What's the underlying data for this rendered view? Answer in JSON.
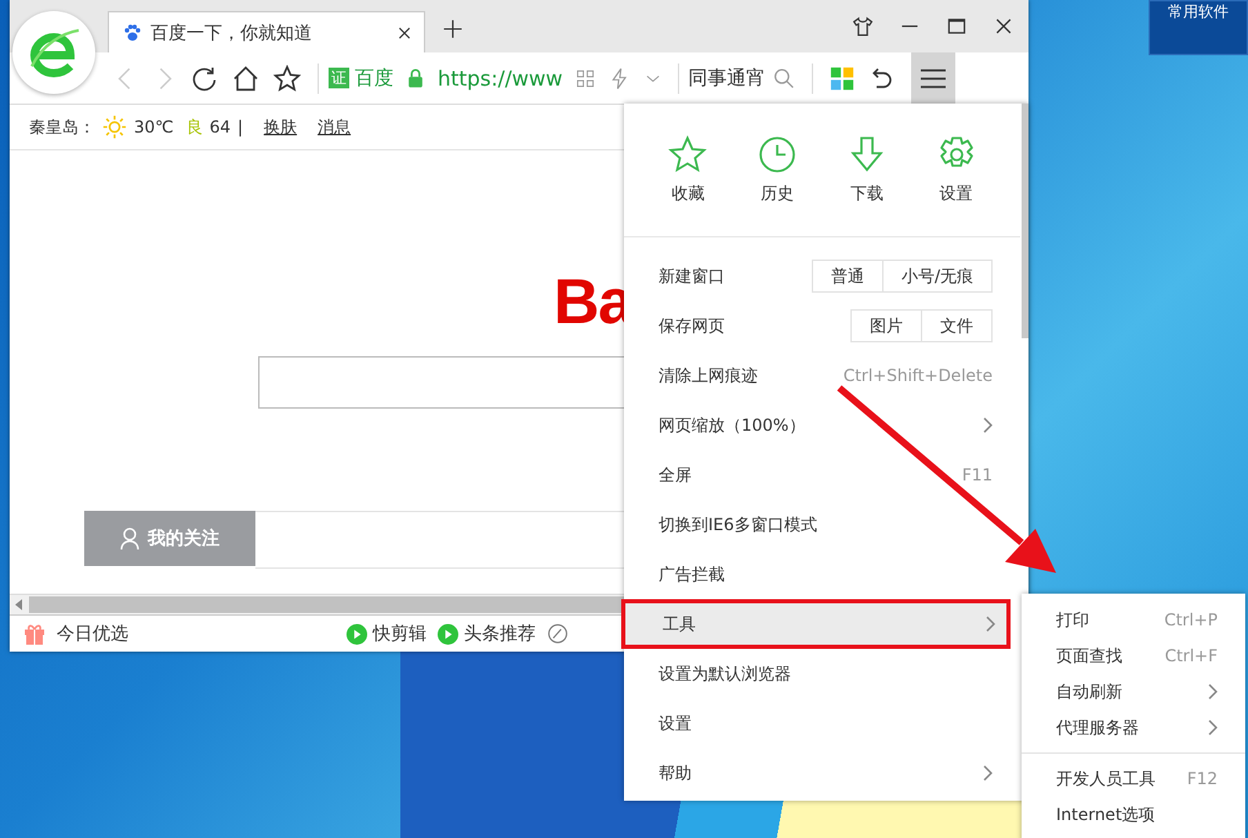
{
  "desktop": {
    "shortcut_label": "常用软件"
  },
  "browser": {
    "tab": {
      "title": "百度一下，你就知道"
    },
    "address": {
      "site_badge": "证",
      "site_name": "百度",
      "url": "https://www"
    },
    "search": {
      "value": "同事通宵"
    },
    "menu_button": {
      "selected": true
    },
    "info_bar": {
      "city": "秦皇岛：",
      "temperature": "30℃",
      "air_quality": "良",
      "aqi": "64",
      "separator": "|",
      "links": [
        "换肤",
        "消息"
      ]
    },
    "page": {
      "logo": "Ba",
      "tab_label": "我的关注"
    },
    "status_bar": {
      "deals": "今日优选",
      "items": [
        "快剪辑",
        "头条推荐"
      ]
    }
  },
  "menu": {
    "top_items": [
      {
        "label": "收藏",
        "kind": "star"
      },
      {
        "label": "历史",
        "kind": "clock"
      },
      {
        "label": "下载",
        "kind": "download"
      },
      {
        "label": "设置",
        "kind": "gear"
      }
    ],
    "items": [
      {
        "label": "新建窗口",
        "kind": "buttons",
        "buttons": [
          "普通",
          "小号/无痕"
        ],
        "selected": false
      },
      {
        "label": "保存网页",
        "kind": "buttons",
        "buttons": [
          "图片",
          "文件"
        ],
        "selected": false
      },
      {
        "label": "清除上网痕迹",
        "kind": "shortcut",
        "shortcut": "Ctrl+Shift+Delete",
        "selected": false
      },
      {
        "label": "网页缩放（100%）",
        "kind": "submenu",
        "selected": false
      },
      {
        "label": "全屏",
        "kind": "shortcut",
        "shortcut": "F11",
        "selected": false
      },
      {
        "label": "切换到IE6多窗口模式",
        "kind": "plain",
        "selected": false
      },
      {
        "label": "广告拦截",
        "kind": "plain",
        "selected": false
      },
      {
        "label": "工具",
        "kind": "submenu",
        "selected": true
      },
      {
        "label": "设置为默认浏览器",
        "kind": "plain",
        "selected": false
      },
      {
        "label": "设置",
        "kind": "plain",
        "selected": false
      },
      {
        "label": "帮助",
        "kind": "submenu",
        "selected": false
      }
    ]
  },
  "submenu": {
    "items": [
      {
        "label": "打印",
        "kind": "shortcut",
        "shortcut": "Ctrl+P"
      },
      {
        "label": "页面查找",
        "kind": "shortcut",
        "shortcut": "Ctrl+F"
      },
      {
        "label": "自动刷新",
        "kind": "submenu"
      },
      {
        "label": "代理服务器",
        "kind": "submenu"
      },
      {
        "kind": "separator"
      },
      {
        "label": "开发人员工具",
        "kind": "shortcut",
        "shortcut": "F12"
      },
      {
        "label": "Internet选项",
        "kind": "plain"
      }
    ]
  }
}
